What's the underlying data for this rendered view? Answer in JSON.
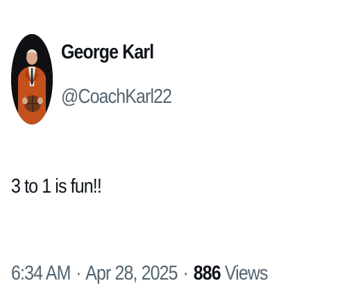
{
  "author": {
    "display_name": "George Karl",
    "handle": "@CoachKarl22",
    "avatar_icon": "profile-photo-man-in-orange-blazer"
  },
  "tweet": {
    "text": "3 to 1 is fun!!"
  },
  "meta": {
    "time": "6:34 AM",
    "separator": "·",
    "date": "Apr 28, 2025",
    "views_count": "886",
    "views_label": "Views"
  },
  "colors": {
    "primary_text": "#0f1419",
    "secondary_text": "#536471",
    "background": "#ffffff",
    "avatar_blazer": "#c4501c",
    "avatar_background": "#101014"
  }
}
